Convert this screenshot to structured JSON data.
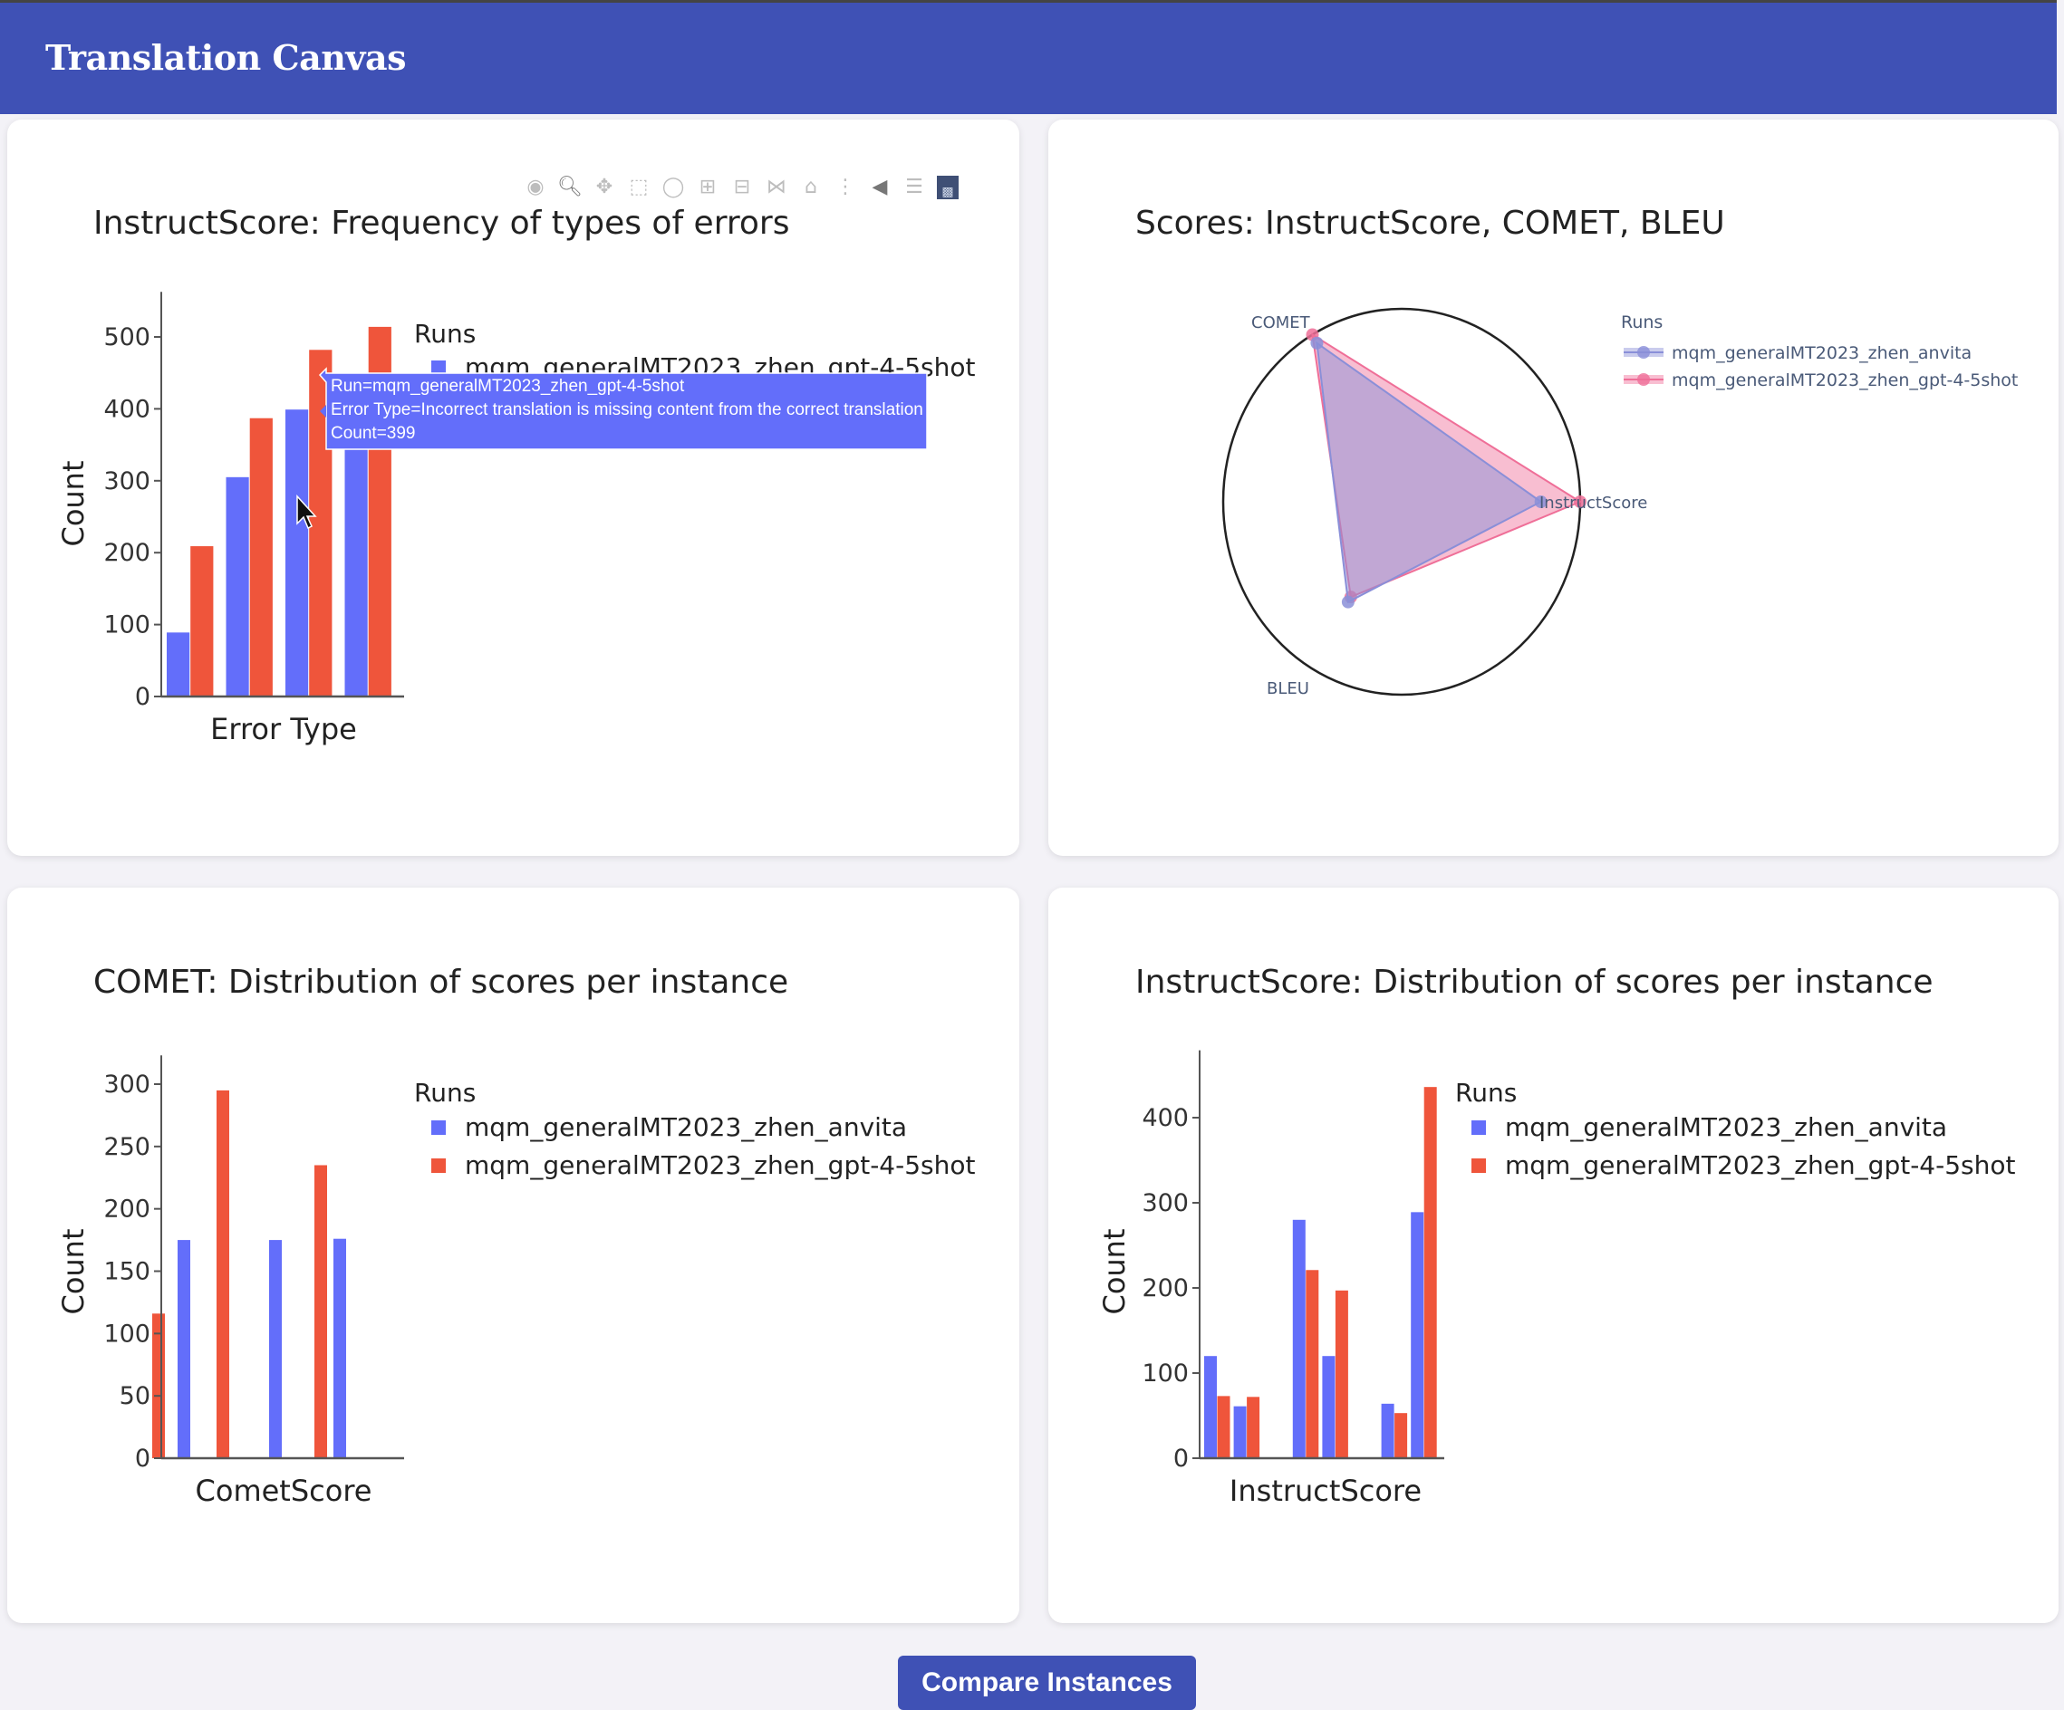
{
  "app": {
    "title": "Translation Canvas"
  },
  "colors": {
    "header": "#3f51b5",
    "run_anvita": "#636efa",
    "run_gpt4": "#ef553b",
    "polar_anvita": "#8a8fd8",
    "polar_gpt4": "#ef6f98"
  },
  "modebar": {
    "icons": [
      "camera-icon",
      "zoom-icon",
      "pan-icon",
      "box-select-icon",
      "lasso-select-icon",
      "zoom-in-icon",
      "zoom-out-icon",
      "autoscale-icon",
      "reset-axes-icon",
      "spike-lines-icon",
      "hover-closest-icon",
      "hover-compare-icon",
      "plotly-logo-icon"
    ]
  },
  "legend": {
    "title": "Runs",
    "runs": [
      "mqm_generalMT2023_zhen_anvita",
      "mqm_generalMT2023_zhen_gpt-4-5shot"
    ]
  },
  "tooltip": {
    "line1": "Run=mqm_generalMT2023_zhen_gpt-4-5shot",
    "line2": "Error Type=Incorrect translation is missing content from the correct translation",
    "line3": "Count=399"
  },
  "actions": {
    "compare_label": "Compare Instances"
  },
  "chart_data": [
    {
      "type": "bar",
      "title": "InstructScore: Frequency of types of errors",
      "xlabel": "Error Type",
      "ylabel": "Count",
      "ylim": [
        0,
        540
      ],
      "yticks": [
        0,
        100,
        200,
        300,
        400,
        500
      ],
      "legend_title": "Runs",
      "legend_visible_entries": [
        "mqm_generalMT2023_zhen_gpt-4-5shot"
      ],
      "legend_placement": "top-right",
      "series": [
        {
          "name": "mqm_generalMT2023_zhen_anvita",
          "values": [
            89,
            305,
            399,
            440
          ]
        },
        {
          "name": "mqm_generalMT2023_zhen_gpt-4-5shot",
          "values": [
            209,
            387,
            482,
            514
          ]
        }
      ]
    },
    {
      "type": "radar",
      "title": "Scores: InstructScore, COMET, BLEU",
      "axes": [
        "InstructScore",
        "COMET",
        "BLEU"
      ],
      "legend_title": "Runs",
      "legend_placement": "top-right",
      "series": [
        {
          "name": "mqm_generalMT2023_zhen_anvita",
          "values": [
            0.78,
            0.95,
            0.6
          ]
        },
        {
          "name": "mqm_generalMT2023_zhen_gpt-4-5shot",
          "values": [
            1.0,
            1.0,
            0.57
          ]
        }
      ]
    },
    {
      "type": "bar",
      "title": "COMET: Distribution of scores per instance",
      "xlabel": "CometScore",
      "ylabel": "Count",
      "ylim": [
        0,
        310
      ],
      "yticks": [
        0,
        50,
        100,
        150,
        200,
        250,
        300
      ],
      "legend_title": "Runs",
      "legend_placement": "top-right",
      "bins": 4,
      "series": [
        {
          "name": "mqm_generalMT2023_zhen_anvita",
          "values": [
            175,
            0,
            175,
            176
          ]
        },
        {
          "name": "mqm_generalMT2023_zhen_gpt-4-5shot",
          "values": [
            116,
            295,
            0,
            235
          ]
        }
      ]
    },
    {
      "type": "bar",
      "title": "InstructScore: Distribution of scores per instance",
      "xlabel": "InstructScore",
      "ylabel": "Count",
      "ylim": [
        0,
        460
      ],
      "yticks": [
        0,
        100,
        200,
        300,
        400
      ],
      "legend_title": "Runs",
      "legend_placement": "top-right",
      "bins": 8,
      "series": [
        {
          "name": "mqm_generalMT2023_zhen_anvita",
          "values": [
            120,
            61,
            0,
            280,
            120,
            0,
            64,
            289
          ]
        },
        {
          "name": "mqm_generalMT2023_zhen_gpt-4-5shot",
          "values": [
            73,
            72,
            0,
            221,
            197,
            0,
            53,
            436
          ]
        }
      ]
    }
  ]
}
